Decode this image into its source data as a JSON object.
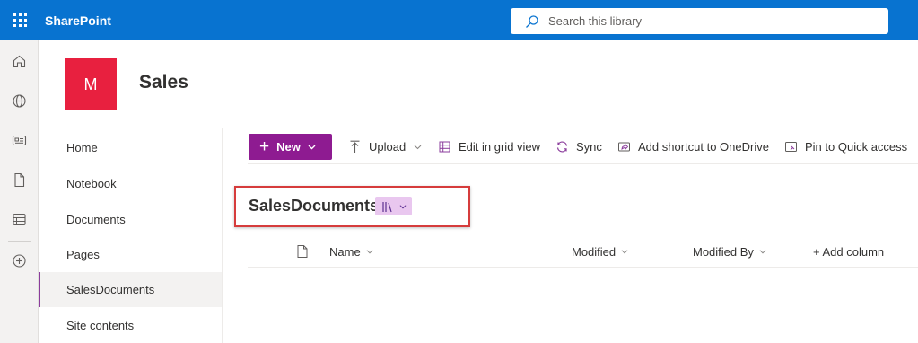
{
  "suite": {
    "brand": "SharePoint",
    "search_placeholder": "Search this library"
  },
  "rail": {
    "items": [
      "home-icon",
      "globe-icon",
      "news-icon",
      "file-icon",
      "list-icon",
      "create-icon"
    ]
  },
  "site": {
    "logo_letter": "M",
    "title": "Sales",
    "logo_color": "#e8203f"
  },
  "nav": {
    "items": [
      {
        "label": "Home"
      },
      {
        "label": "Notebook"
      },
      {
        "label": "Documents"
      },
      {
        "label": "Pages"
      },
      {
        "label": "SalesDocuments",
        "selected": true
      },
      {
        "label": "Site contents"
      }
    ]
  },
  "commands": {
    "new_label": "New",
    "upload_label": "Upload",
    "edit_grid_label": "Edit in grid view",
    "sync_label": "Sync",
    "shortcut_label": "Add shortcut to OneDrive",
    "pin_label": "Pin to Quick access"
  },
  "library": {
    "title": "SalesDocuments",
    "view_icon": "library-icon"
  },
  "columns": {
    "name": "Name",
    "modified": "Modified",
    "modified_by": "Modified By",
    "add_column": "+ Add column"
  },
  "colors": {
    "suite_bar": "#0873d0",
    "accent": "#8e1b91",
    "highlight": "#d63c3c"
  }
}
